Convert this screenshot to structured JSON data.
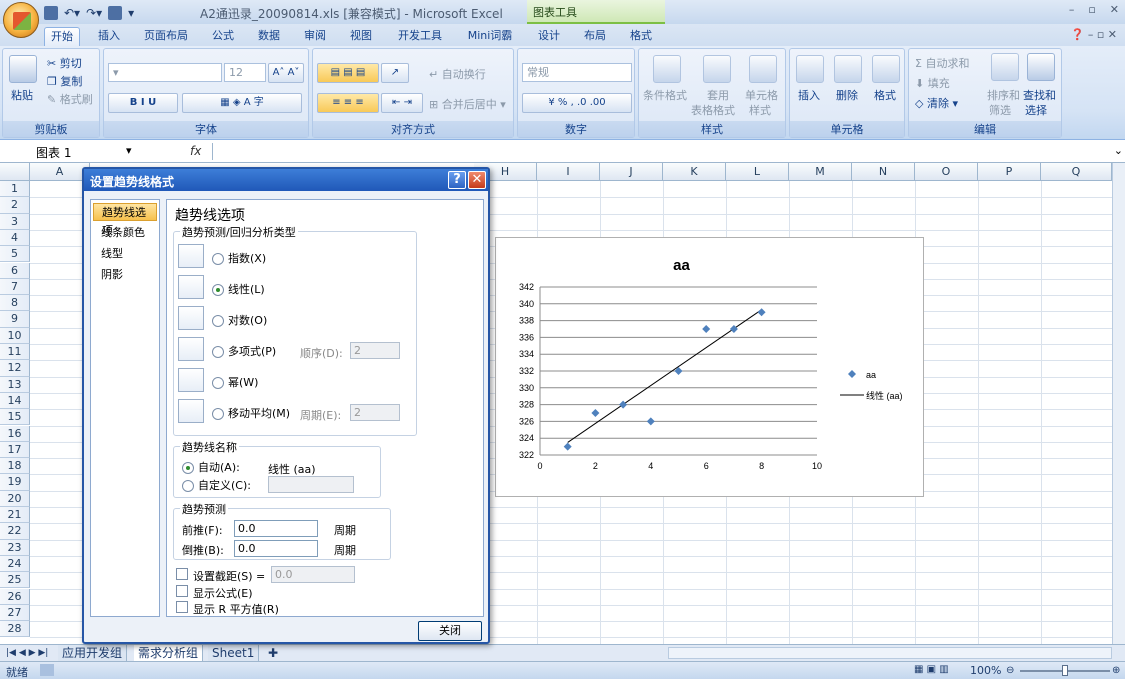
{
  "window": {
    "title": "A2通迅录_20090814.xls  [兼容模式] - Microsoft Excel",
    "context_group": "图表工具"
  },
  "tabs": [
    "开始",
    "插入",
    "页面布局",
    "公式",
    "数据",
    "审阅",
    "视图",
    "开发工具",
    "Mini词霸",
    "设计",
    "布局",
    "格式"
  ],
  "ribbon": {
    "clipboard": {
      "label": "剪贴板",
      "paste": "粘贴",
      "cut": "剪切",
      "copy": "复制",
      "format_painter": "格式刷"
    },
    "font": {
      "label": "字体",
      "size": "12"
    },
    "align": {
      "label": "对齐方式",
      "wrap": "自动换行",
      "merge": "合并后居中"
    },
    "number": {
      "label": "数字",
      "format": "常规"
    },
    "styles": {
      "label": "样式",
      "cond": "条件格式",
      "table1": "套用",
      "table2": "表格格式",
      "cell1": "单元格",
      "cell2": "样式"
    },
    "cells": {
      "label": "单元格",
      "insert": "插入",
      "delete": "删除",
      "format": "格式"
    },
    "edit": {
      "label": "编辑",
      "autosum": "自动求和",
      "fill": "填充",
      "clear": "清除",
      "sort1": "排序和",
      "sort2": "筛选",
      "find1": "查找和",
      "find2": "选择"
    }
  },
  "formula_bar": {
    "name_box": "图表 1",
    "fx": "fx"
  },
  "columns": [
    "A",
    "H",
    "I",
    "J",
    "K",
    "L",
    "M",
    "N",
    "O",
    "P",
    "Q"
  ],
  "rows": [
    "1",
    "2",
    "3",
    "4",
    "5",
    "6",
    "7",
    "8",
    "9",
    "10",
    "11",
    "12",
    "13",
    "14",
    "15",
    "16",
    "17",
    "18",
    "19",
    "20",
    "21",
    "22",
    "23",
    "24",
    "25",
    "26",
    "27",
    "28"
  ],
  "sheet_tabs": [
    "应用开发组",
    "需求分析组",
    "Sheet1"
  ],
  "status": {
    "ready": "就绪",
    "zoom": "100%"
  },
  "dialog": {
    "title": "设置趋势线格式",
    "help": "?",
    "close": "✕",
    "nav": [
      "趋势线选项",
      "线条颜色",
      "线型",
      "阴影"
    ],
    "section_title": "趋势线选项",
    "type_group": "趋势预测/回归分析类型",
    "types": [
      "指数(X)",
      "线性(L)",
      "对数(O)",
      "多项式(P)",
      "幂(W)",
      "移动平均(M)"
    ],
    "order_label": "顺序(D):",
    "order_value": "2",
    "period_label": "周期(E):",
    "period_value": "2",
    "name_group": "趋势线名称",
    "auto_label": "自动(A):",
    "auto_value": "线性 (aa)",
    "custom_label": "自定义(C):",
    "forecast_group": "趋势预测",
    "forward_label": "前推(F):",
    "forward_value": "0.0",
    "backward_label": "倒推(B):",
    "backward_value": "0.0",
    "unit": "周期",
    "intercept_label": "设置截距(S) =",
    "intercept_value": "0.0",
    "show_eq": "显示公式(E)",
    "show_r2": "显示 R 平方值(R)",
    "close_btn": "关闭"
  },
  "chart_data": {
    "type": "scatter",
    "title": "aa",
    "xlim": [
      0,
      10
    ],
    "ylim": [
      322,
      342
    ],
    "x_ticks": [
      "0",
      "2",
      "4",
      "6",
      "8",
      "10"
    ],
    "y_ticks": [
      "322",
      "324",
      "326",
      "328",
      "330",
      "332",
      "334",
      "336",
      "338",
      "340",
      "342"
    ],
    "series": [
      {
        "name": "aa",
        "x": [
          1,
          2,
          3,
          4,
          5,
          6,
          7,
          8
        ],
        "y": [
          323,
          327,
          328,
          326,
          332,
          337,
          337,
          339
        ]
      }
    ],
    "trendline": {
      "name": "线性 (aa)",
      "x": [
        1,
        8
      ],
      "y": [
        323.5,
        339.3
      ]
    },
    "grid": "horizontal",
    "legend": "right",
    "colors": {
      "marker": "#4f81bd",
      "line": "#000000"
    }
  }
}
